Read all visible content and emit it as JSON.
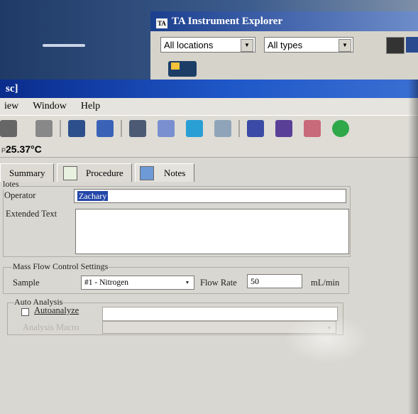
{
  "explorer": {
    "title": "TA Instrument Explorer",
    "logo_text": "TA",
    "location_select": "All locations",
    "type_select": "All types"
  },
  "window": {
    "title": "sc]",
    "menu": [
      "iew",
      "Window",
      "Help"
    ]
  },
  "status": {
    "temperature_label": "P",
    "temperature": "25.37°C"
  },
  "tabs": [
    {
      "label": "Summary"
    },
    {
      "label": "Procedure"
    },
    {
      "label": "Notes",
      "active": true
    }
  ],
  "notes": {
    "group_label": "lotes",
    "operator_label": "Operator",
    "operator_value": "Zachary",
    "extended_text_label": "Extended Text",
    "extended_text_value": ""
  },
  "mass_flow": {
    "group_label": "Mass Flow Control Settings",
    "sample_label": "Sample",
    "sample_value": "#1 - Nitrogen",
    "flow_rate_label": "Flow Rate",
    "flow_rate_value": "50",
    "flow_rate_unit": "mL/min"
  },
  "auto_analysis": {
    "group_label": "Auto Analysis",
    "autoanalyze_label": "Autoanalyze",
    "autoanalyze_checked": false,
    "macro_label": "Analysis Macro",
    "macro_value": ""
  },
  "colors": {
    "titlebar": "#1f57c8",
    "selection": "#2447a8",
    "window_bg": "#d9d7d1"
  }
}
